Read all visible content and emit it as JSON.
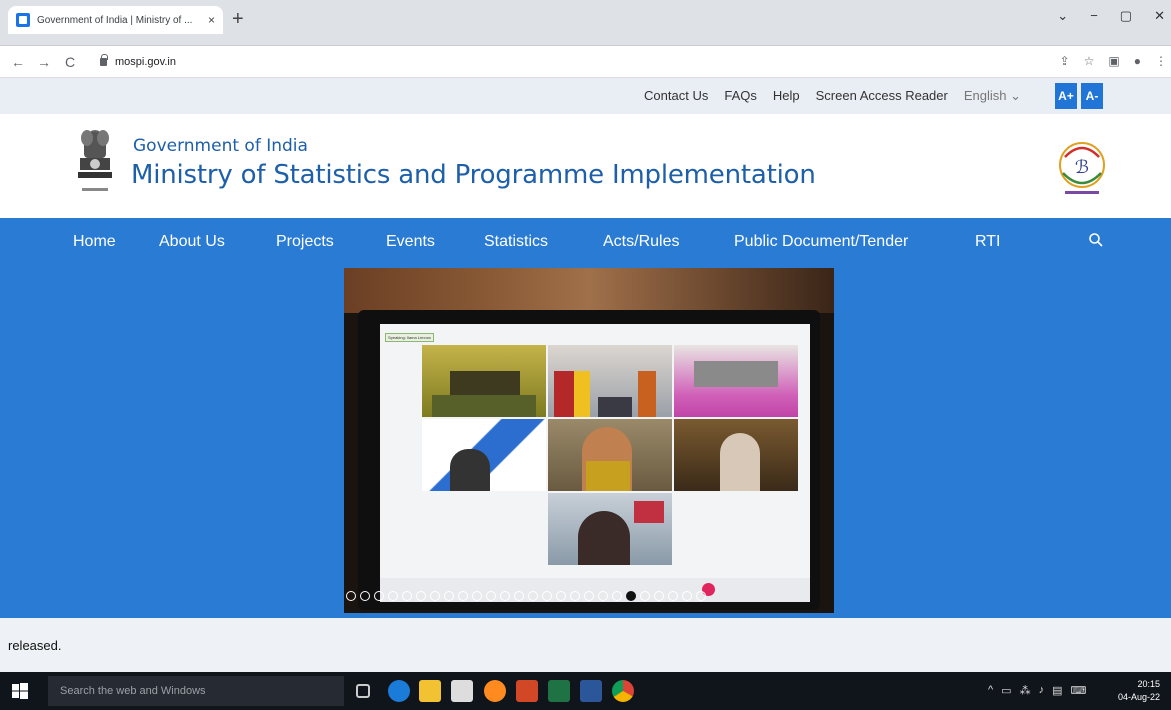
{
  "browser": {
    "tab_title": "Government of India | Ministry of ...",
    "tab_close": "×",
    "new_tab": "+",
    "url": "mospi.gov.in",
    "window_controls": [
      "⌄",
      "−",
      "▢",
      "✕"
    ],
    "nav": {
      "back": "←",
      "forward": "→",
      "reload": "C"
    }
  },
  "utility": {
    "links": [
      "Contact Us",
      "FAQs",
      "Help",
      "Screen Access Reader",
      "English ⌄"
    ],
    "font_plus": "A+",
    "font_minus": "A-"
  },
  "header": {
    "gov_title": "Government of India",
    "ministry_title": "Ministry of Statistics and Programme Implementation"
  },
  "main_nav": {
    "items": [
      "Home",
      "About Us",
      "Projects",
      "Events",
      "Statistics",
      "Acts/Rules",
      "Public Document/Tender",
      "RTI"
    ]
  },
  "carousel": {
    "dot_count": 26,
    "active_index": 20
  },
  "ticker": {
    "text": "released."
  },
  "taskbar": {
    "search_placeholder": "Search the web and Windows",
    "time": "20:15",
    "date": "04-Aug-22",
    "tray_icons": [
      "^",
      "▭",
      "⁂",
      "♪",
      "▤",
      "⌨"
    ]
  },
  "colors": {
    "nav_blue": "#2a7bd4",
    "title_blue": "#1e5faa",
    "font_btn": "#2175d6"
  }
}
